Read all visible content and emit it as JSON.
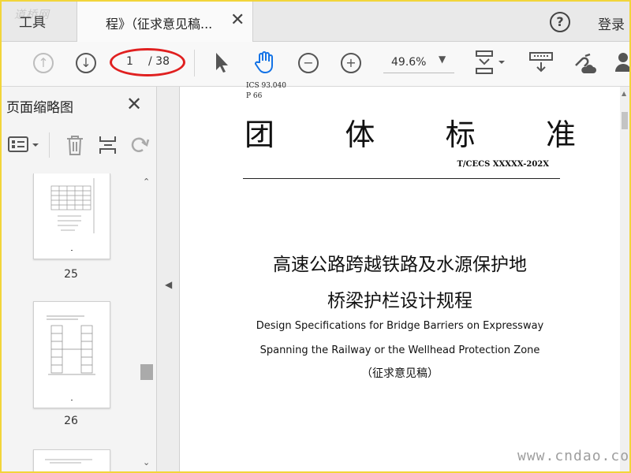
{
  "tabs": {
    "tools_label": "工具",
    "doc_title": "程》（征求意见稿...",
    "login": "登录",
    "help_glyph": "?",
    "close_glyph": "✕"
  },
  "watermark_top_left": "道桥网",
  "toolbar": {
    "page_current": "1",
    "page_total": "/ 38",
    "zoom": "49.6%"
  },
  "thumbnails_panel": {
    "title": "页面缩略图",
    "close_glyph": "✕",
    "pages": [
      "25",
      "26"
    ]
  },
  "document": {
    "ics_code": "ICS 93.040",
    "p_code": "P 66",
    "title_chars": [
      "团",
      "体",
      "标",
      "准"
    ],
    "standard_no": "T/CECS XXXXX-202X",
    "title_cn_line1": "高速公路跨越铁路及水源保护地",
    "title_cn_line2": "桥梁护栏设计规程",
    "title_en_line1": "Design Specifications for Bridge Barriers on Expressway",
    "title_en_line2": "Spanning the Railway or the Wellhead Protection Zone",
    "draft_note": "（征求意见稿）"
  },
  "watermark_bottom_right": "www.cndao.com",
  "colors": {
    "highlight_ellipse": "#e02020",
    "frame_border": "#f2d53a",
    "accent_hand": "#1473e6"
  }
}
